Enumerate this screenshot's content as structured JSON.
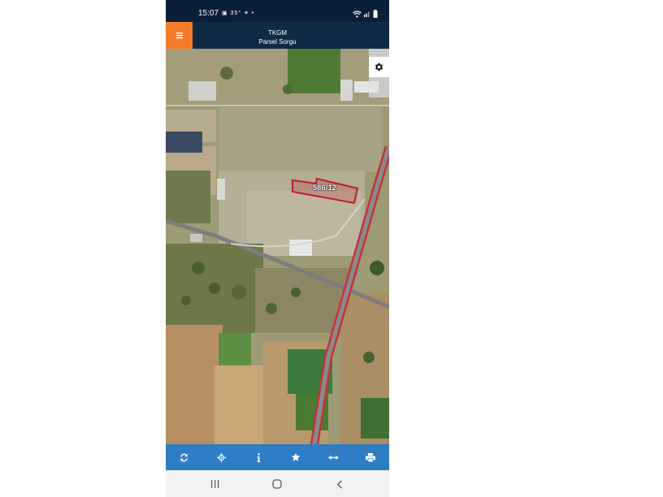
{
  "status_bar": {
    "time": "15:07",
    "left_icons": "▣ 35° ✶ •"
  },
  "header": {
    "title": "TKGM",
    "subtitle": "Parsel Sorgu",
    "menu_icon": "hamburger-icon"
  },
  "map": {
    "parcel_label": "586/12",
    "parcel_outline_color": "#c01a2a",
    "settings_icon": "gear-icon"
  },
  "toolbar": {
    "items": [
      {
        "icon": "refresh-icon"
      },
      {
        "icon": "locate-icon"
      },
      {
        "icon": "info-icon"
      },
      {
        "icon": "star-icon"
      },
      {
        "icon": "measure-icon"
      },
      {
        "icon": "print-icon"
      }
    ]
  },
  "nav_bar": {
    "items": [
      "recent-apps-icon",
      "home-icon",
      "back-icon"
    ]
  },
  "colors": {
    "header_bg": "#0f2a45",
    "menu_accent": "#f57b2b",
    "toolbar_bg": "#2f7dc5",
    "navbar_bg": "#f2f2f4"
  }
}
